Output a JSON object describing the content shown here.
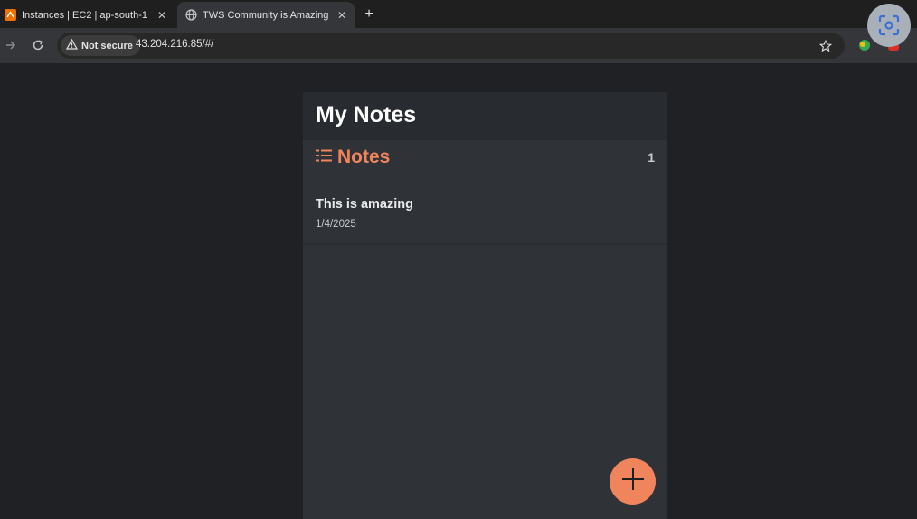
{
  "browser": {
    "tabs": [
      {
        "title": "Instances | EC2 | ap-south-1",
        "favicon": "aws-icon",
        "active": false
      },
      {
        "title": "TWS Community is Amazing",
        "favicon": "globe-icon",
        "active": true
      }
    ],
    "omnibox": {
      "security_label": "Not secure",
      "url": "43.204.216.85/#/"
    }
  },
  "app": {
    "title": "My Notes",
    "notes_section": {
      "heading": "Notes",
      "count": "1"
    },
    "notes": [
      {
        "title": "This is amazing",
        "date": "1/4/2025"
      }
    ]
  },
  "colors": {
    "accent": "#f0845c",
    "app_background": "#2f3236",
    "page_background": "#202124"
  }
}
